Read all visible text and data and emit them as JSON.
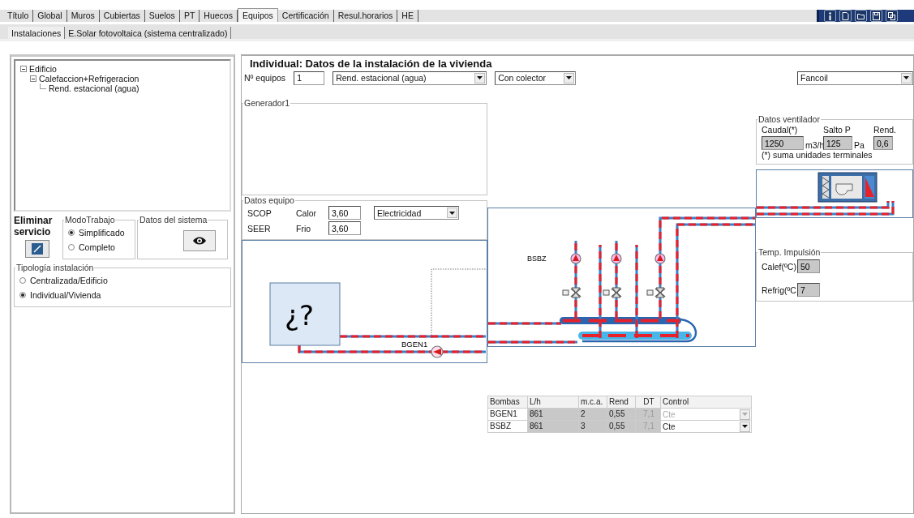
{
  "main_tabs": [
    {
      "label": "Título",
      "selected": false
    },
    {
      "label": "Global",
      "selected": false
    },
    {
      "label": "Muros",
      "selected": false
    },
    {
      "label": "Cubiertas",
      "selected": false
    },
    {
      "label": "Suelos",
      "selected": false
    },
    {
      "label": "PT",
      "selected": false
    },
    {
      "label": "Huecos",
      "selected": false
    },
    {
      "label": "Equipos",
      "selected": true
    },
    {
      "label": "Certificación",
      "selected": false
    },
    {
      "label": "Resul.horarios",
      "selected": false
    },
    {
      "label": "HE",
      "selected": false
    }
  ],
  "sub_tabs": [
    {
      "label": "Instalaciones",
      "selected": true
    },
    {
      "label": "E.Solar fotovoltaica (sistema centralizado)",
      "selected": false
    }
  ],
  "tree": [
    {
      "label": "Edificio",
      "expanded": true,
      "children": [
        {
          "label": "Calefaccion+Refrigeracion",
          "expanded": true,
          "children": [
            {
              "label": "Rend. estacional (agua)"
            }
          ]
        }
      ]
    }
  ],
  "delete_service": {
    "label": "Eliminar servicio"
  },
  "work_mode": {
    "title": "ModoTrabajo",
    "options": [
      {
        "label": "Simplificado",
        "selected": true
      },
      {
        "label": "Completo",
        "selected": false
      }
    ]
  },
  "system_data": {
    "title": "Datos del sistema"
  },
  "installation_type": {
    "title": "Tipología instalación",
    "options": [
      {
        "label": "Centralizada/Edificio",
        "selected": false
      },
      {
        "label": "Individual/Vivienda",
        "selected": true
      }
    ]
  },
  "form": {
    "title": "Individual: Datos de la instalación de la vivienda",
    "units_label": "Nº equipos",
    "units_value": "1",
    "system_select": "Rend. estacional (agua)",
    "collector_select": "Con colector",
    "terminal_select": "Fancoil"
  },
  "generator": {
    "title": "Generador1"
  },
  "equipment": {
    "title": "Datos equipo",
    "rows": [
      {
        "name": "SCOP",
        "mode": "Calor",
        "value": "3,60"
      },
      {
        "name": "SEER",
        "mode": "Frio",
        "value": "3,60"
      }
    ],
    "fuel": "Electricidad"
  },
  "diagram": {
    "generator_symbol": "¿?",
    "generator_pump": "BGEN1",
    "secondary_pump": "BSBZ"
  },
  "fan": {
    "title": "Datos ventilador",
    "flow_label": "Caudal(*)",
    "flow_value": "1250",
    "flow_unit": "m3/h",
    "pressure_label": "Salto P",
    "pressure_value": "125",
    "pressure_unit": "Pa",
    "efficiency_label": "Rend.",
    "efficiency_value": "0,6",
    "note": "(*) suma unidades terminales"
  },
  "supply_temp": {
    "title": "Temp. Impulsión",
    "heating_label": "Calef(ºC)",
    "heating_value": "50",
    "cooling_label": "Refrig(ºC",
    "cooling_value": "7"
  },
  "pumps_table": {
    "columns": [
      "Bombas",
      "L/h",
      "m.c.a.",
      "Rend",
      "DT",
      "Control"
    ],
    "rows": [
      {
        "cells": [
          "BGEN1",
          "861",
          "2",
          "0,55",
          "7,1"
        ],
        "control": "Cte",
        "disabled": true
      },
      {
        "cells": [
          "BSBZ",
          "861",
          "3",
          "0,55",
          "7,1"
        ],
        "control": "Cte",
        "disabled": false
      }
    ]
  }
}
